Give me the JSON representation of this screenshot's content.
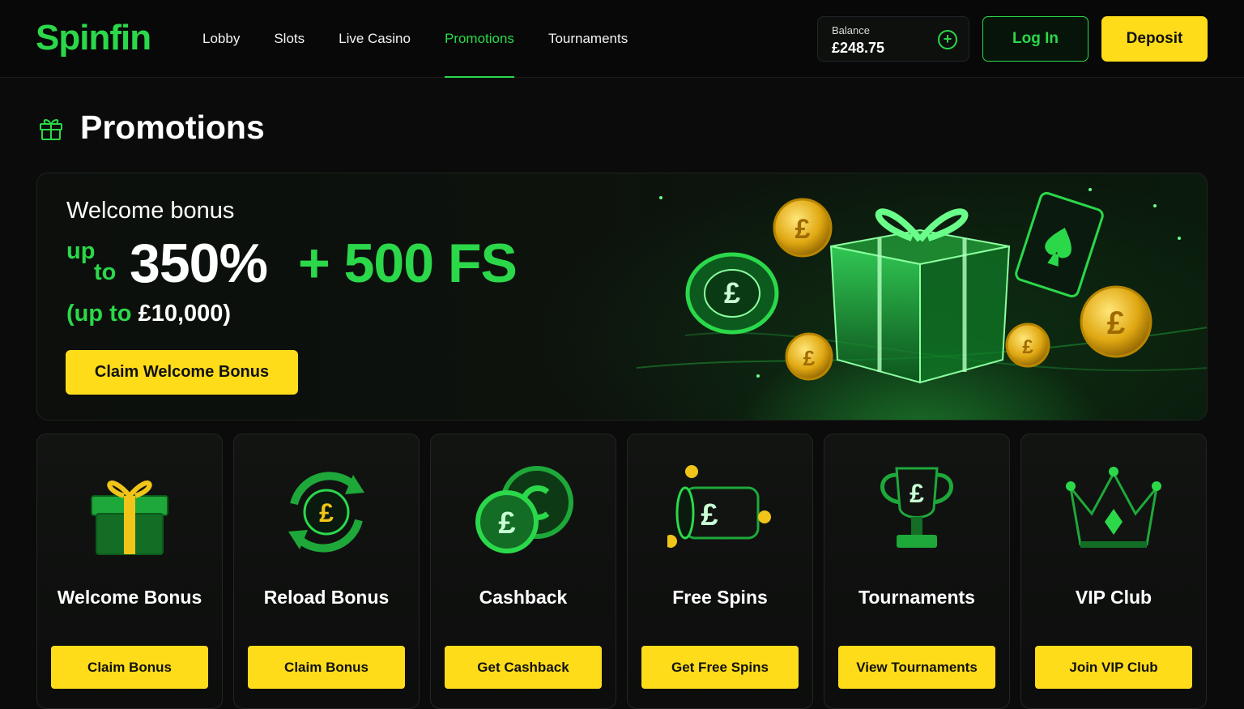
{
  "header": {
    "logo": "Spinfin",
    "nav": [
      {
        "label": "Lobby",
        "active": false
      },
      {
        "label": "Slots",
        "active": false
      },
      {
        "label": "Live Casino",
        "active": false
      },
      {
        "label": "Promotions",
        "active": true
      },
      {
        "label": "Tournaments",
        "active": false
      }
    ],
    "balance_label": "Balance",
    "balance_value": "£248.75",
    "add_symbol": "+",
    "login_label": "Log In",
    "deposit_label": "Deposit"
  },
  "page": {
    "title": "Promotions",
    "title_icon": "gift-icon"
  },
  "hero": {
    "kicker": "Welcome bonus",
    "up": "up",
    "to": "to",
    "percent": "350%",
    "free_spins": "+ 500 FS",
    "cap_prefix": "(up to ",
    "cap_amount": "£10,000)",
    "cta_label": "Claim Welcome Bonus",
    "art_icons": [
      "gift-box-icon",
      "casino-chip-icon",
      "gold-coin-icon",
      "ace-of-spades-card-icon"
    ]
  },
  "promos": [
    {
      "title": "Welcome Bonus",
      "button": "Claim Bonus",
      "icon": "gift-icon"
    },
    {
      "title": "Reload Bonus",
      "button": "Claim Bonus",
      "icon": "reload-coin-icon"
    },
    {
      "title": "Cashback",
      "button": "Get Cashback",
      "icon": "cashback-coins-icon"
    },
    {
      "title": "Free Spins",
      "button": "Get Free Spins",
      "icon": "slot-reel-icon"
    },
    {
      "title": "Tournaments",
      "button": "View Tournaments",
      "icon": "trophy-icon"
    },
    {
      "title": "VIP Club",
      "button": "Join VIP Club",
      "icon": "crown-icon"
    }
  ],
  "colors": {
    "accent_green": "#2bd84a",
    "accent_yellow": "#ffdc19",
    "background": "#0a0b0a"
  }
}
